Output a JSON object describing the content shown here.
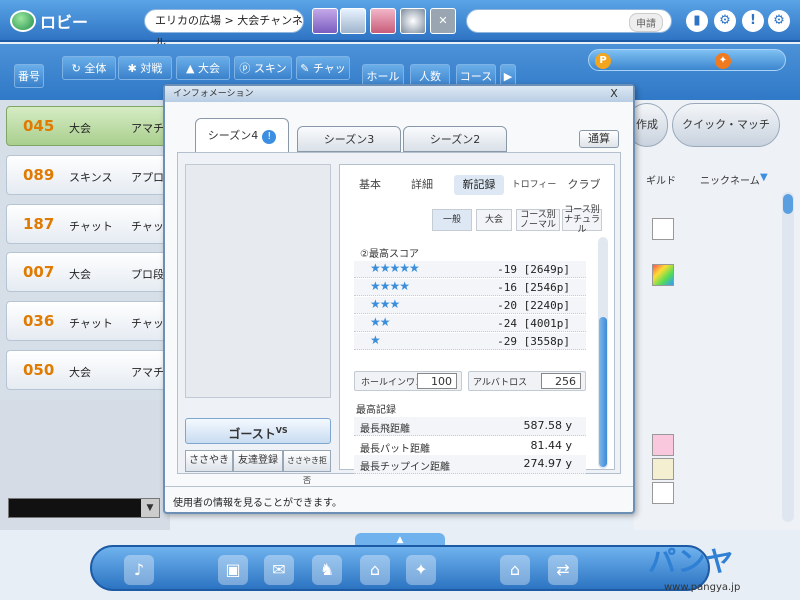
{
  "topbar": {
    "lobby_label": "ロビー",
    "channel": "エリカの広場 > 大会チャンネル",
    "search_button": "申請"
  },
  "filters": {
    "number": "番号",
    "all": "全体",
    "versus": "対戦",
    "tournament": "大会",
    "skins": "スキンス",
    "chat": "チャット",
    "holes": "ホール数",
    "players": "人数",
    "course": "コース",
    "next": "▶"
  },
  "rooms": [
    {
      "num": "045",
      "type": "大会",
      "mode": "アマチュア"
    },
    {
      "num": "089",
      "type": "スキンス",
      "mode": "アプロー"
    },
    {
      "num": "187",
      "type": "チャット",
      "mode": "チャットル"
    },
    {
      "num": "007",
      "type": "大会",
      "mode": "プロ段"
    },
    {
      "num": "036",
      "type": "チャット",
      "mode": "チャットル"
    },
    {
      "num": "050",
      "type": "大会",
      "mode": "アマチュア"
    }
  ],
  "right_panel": {
    "create_button": "作成",
    "quick_match_button": "クイック・マッチ",
    "col_guild": "ギルド",
    "col_nickname": "ニックネーム"
  },
  "dialog": {
    "title": "インフォメーション",
    "close": "X",
    "tabs": [
      "シーズン4",
      "シーズン3",
      "シーズン2"
    ],
    "tab_badge": "!",
    "total_button": "通算",
    "ghost_button": "ゴースト",
    "ghost_sup": "VS",
    "whisper": "ささやき",
    "add_friend": "友達登録",
    "block_whisper": "ささやき拒否",
    "sub_tabs": [
      "基本",
      "詳細",
      "新記録",
      "トロフィー",
      "クラブ"
    ],
    "mini_tabs": [
      "一般",
      "大会",
      "コース別ノーマル",
      "コース別ナチュラル"
    ],
    "best_score_title": "②最高スコア",
    "scores": [
      {
        "stars": "★★★★★",
        "value": "-19 [2649p]"
      },
      {
        "stars": "★★★★",
        "value": "-16 [2546p]"
      },
      {
        "stars": "★★★",
        "value": "-20 [2240p]"
      },
      {
        "stars": "★★",
        "value": "-24 [4001p]"
      },
      {
        "stars": "★",
        "value": "-29 [3558p]"
      }
    ],
    "hole_in_one_label": "ホールインワン",
    "hole_in_one_value": "100",
    "albatross_label": "アルバトロス",
    "albatross_value": "256",
    "records_title": "最高記録",
    "records": [
      {
        "label": "最長飛距離",
        "value": "587.58 y"
      },
      {
        "label": "最長パット距離",
        "value": "81.44 y"
      },
      {
        "label": "最長チップイン距離",
        "value": "274.97 y"
      }
    ],
    "status_text": "使用者の情報を見ることができます。"
  },
  "logo": {
    "url": "www.pangya.jp",
    "mark": "パンヤ"
  },
  "colors": {
    "accent": "#2f74c4",
    "room_number": "#e07a00",
    "star": "#3a8edb"
  }
}
